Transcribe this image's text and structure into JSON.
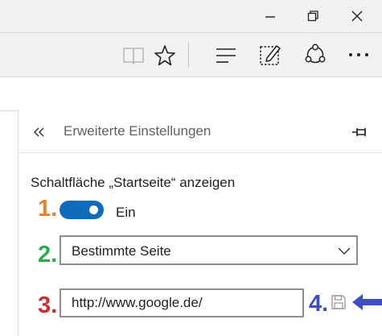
{
  "window": {
    "controls": [
      "minimize-icon",
      "restore-icon",
      "close-icon"
    ]
  },
  "toolbar": {
    "icons": [
      "reading-view-icon",
      "favorite-star-icon",
      "hub-icon",
      "web-note-icon",
      "share-icon",
      "more-icon"
    ]
  },
  "settings_panel": {
    "back_icon": "double-chevron-left-icon",
    "title": "Erweiterte Einstellungen",
    "pin_icon": "pin-icon",
    "home_button": {
      "label": "Schaltfläche „Startseite“ anzeigen",
      "toggle_state_label": "Ein",
      "toggle_on": true
    },
    "page_select": {
      "value": "Bestimmte Seite"
    },
    "url_input": {
      "value": "http://www.google.de/"
    },
    "save_icon": "save-icon"
  },
  "annotations": {
    "step1": "1.",
    "step2": "2.",
    "step3": "3.",
    "step4": "4.",
    "colors": {
      "step1": "#e8822a",
      "step2": "#2eab4e",
      "step3": "#d02b2b",
      "step4": "#3d4fc0",
      "arrow": "#3d4fc0"
    }
  },
  "colors": {
    "chrome_bg": "#f2f2f2",
    "toggle_on": "#0f6cbd"
  }
}
